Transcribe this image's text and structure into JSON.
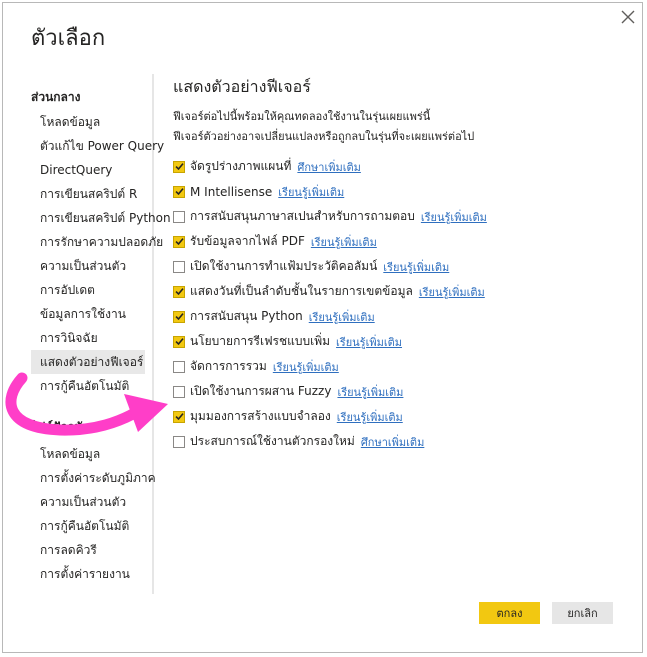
{
  "dialog": {
    "title": "ตัวเลือก",
    "ok_label": "ตกลง",
    "cancel_label": "ยกเลิก"
  },
  "sidebar": {
    "global_header": "ส่วนกลาง",
    "global_items": [
      "โหลดข้อมูล",
      "ตัวแก้ไข Power Query",
      "DirectQuery",
      "การเขียนสคริปต์ R",
      "การเขียนสคริปต์ Python",
      "การรักษาความปลอดภัย",
      "ความเป็นส่วนตัว",
      "การอัปเดต",
      "ข้อมูลการใช้งาน",
      "การวินิจฉัย",
      "แสดงตัวอย่างฟีเจอร์",
      "การกู้คืนอัตโนมัติ"
    ],
    "selected_item": "แสดงตัวอย่างฟีเจอร์",
    "current_file_header": "ไฟล์ปัจจุบัน",
    "current_file_items": [
      "โหลดข้อมูล",
      "การตั้งค่าระดับภูมิภาค",
      "ความเป็นส่วนตัว",
      "การกู้คืนอัตโนมัติ",
      "การลดคิวรี",
      "การตั้งค่ารายงาน"
    ]
  },
  "content": {
    "title": "แสดงตัวอย่างฟีเจอร์",
    "desc_line1": "ฟีเจอร์ต่อไปนี้พร้อมให้คุณทดลองใช้งานในรุ่นเผยแพร่นี้",
    "desc_line2": "ฟีเจอร์ตัวอย่างอาจเปลี่ยนแปลงหรือถูกลบในรุ่นที่จะเผยแพร่ต่อไป",
    "features": [
      {
        "label": "จัดรูปร่างภาพแผนที่",
        "link": "ศึกษาเพิ่มเติม",
        "checked": true
      },
      {
        "label": "M Intellisense",
        "link": "เรียนรู้เพิ่มเติม",
        "checked": true
      },
      {
        "label": "การสนับสนุนภาษาสเปนสำหรับการถามตอบ",
        "link": "เรียนรู้เพิ่มเติม",
        "checked": false
      },
      {
        "label": "รับข้อมูลจากไฟล์ PDF",
        "link": "เรียนรู้เพิ่มเติม",
        "checked": true
      },
      {
        "label": "เปิดใช้งานการทำแฟ้มประวัติคอลัมน์",
        "link": "เรียนรู้เพิ่มเติม",
        "checked": false
      },
      {
        "label": "แสดงวันที่เป็นลำดับชั้นในรายการเขตข้อมูล",
        "link": "เรียนรู้เพิ่มเติม",
        "checked": true
      },
      {
        "label": "การสนับสนุน Python",
        "link": "เรียนรู้เพิ่มเติม",
        "checked": true
      },
      {
        "label": "นโยบายการรีเฟรชแบบเพิ่ม",
        "link": "เรียนรู้เพิ่มเติม",
        "checked": true
      },
      {
        "label": "จัดการการรวม",
        "link": "เรียนรู้เพิ่มเติม",
        "checked": false
      },
      {
        "label": "เปิดใช้งานการผสาน Fuzzy",
        "link": "เรียนรู้เพิ่มเติม",
        "checked": false
      },
      {
        "label": "มุมมองการสร้างแบบจำลอง",
        "link": "เรียนรู้เพิ่มเติม",
        "checked": true
      },
      {
        "label": "ประสบการณ์ใช้งานตัวกรองใหม่",
        "link": "ศึกษาเพิ่มเติม",
        "checked": false
      }
    ]
  },
  "annotation": {
    "arrow_color": "#ff3ec8",
    "accent_color": "#f2c811"
  }
}
